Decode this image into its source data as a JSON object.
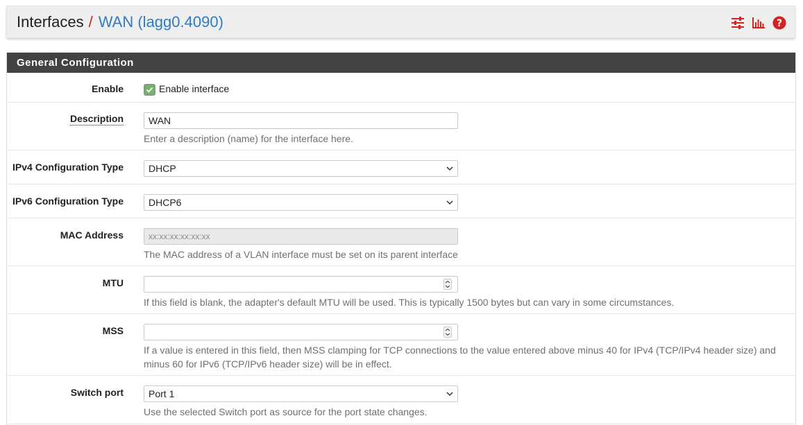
{
  "breadcrumb": {
    "root": "Interfaces",
    "separator": "/",
    "current": "WAN (lagg0.4090)"
  },
  "header_icons": [
    "sliders-icon",
    "bar-chart-icon",
    "help-icon"
  ],
  "accent_color": "#d22222",
  "link_color": "#317cc0",
  "panel": {
    "title": "General Configuration"
  },
  "fields": {
    "enable": {
      "label": "Enable",
      "checkbox_label": "Enable interface",
      "checked": true
    },
    "description": {
      "label": "Description",
      "value": "WAN",
      "help": "Enter a description (name) for the interface here."
    },
    "ipv4_type": {
      "label": "IPv4 Configuration Type",
      "value": "DHCP"
    },
    "ipv6_type": {
      "label": "IPv6 Configuration Type",
      "value": "DHCP6"
    },
    "mac": {
      "label": "MAC Address",
      "placeholder": "xx:xx:xx:xx:xx:xx",
      "help": "The MAC address of a VLAN interface must be set on its parent interface"
    },
    "mtu": {
      "label": "MTU",
      "value": "",
      "help": "If this field is blank, the adapter's default MTU will be used. This is typically 1500 bytes but can vary in some circumstances."
    },
    "mss": {
      "label": "MSS",
      "value": "",
      "help_line1": "If a value is entered in this field, then MSS clamping for TCP connections to the value entered above minus 40 for IPv4 (TCP/IPv4 header size) and",
      "help_line2": "minus 60 for IPv6 (TCP/IPv6 header size) will be in effect."
    },
    "switch_port": {
      "label": "Switch port",
      "value": "Port 1",
      "help": "Use the selected Switch port as source for the port state changes."
    }
  }
}
